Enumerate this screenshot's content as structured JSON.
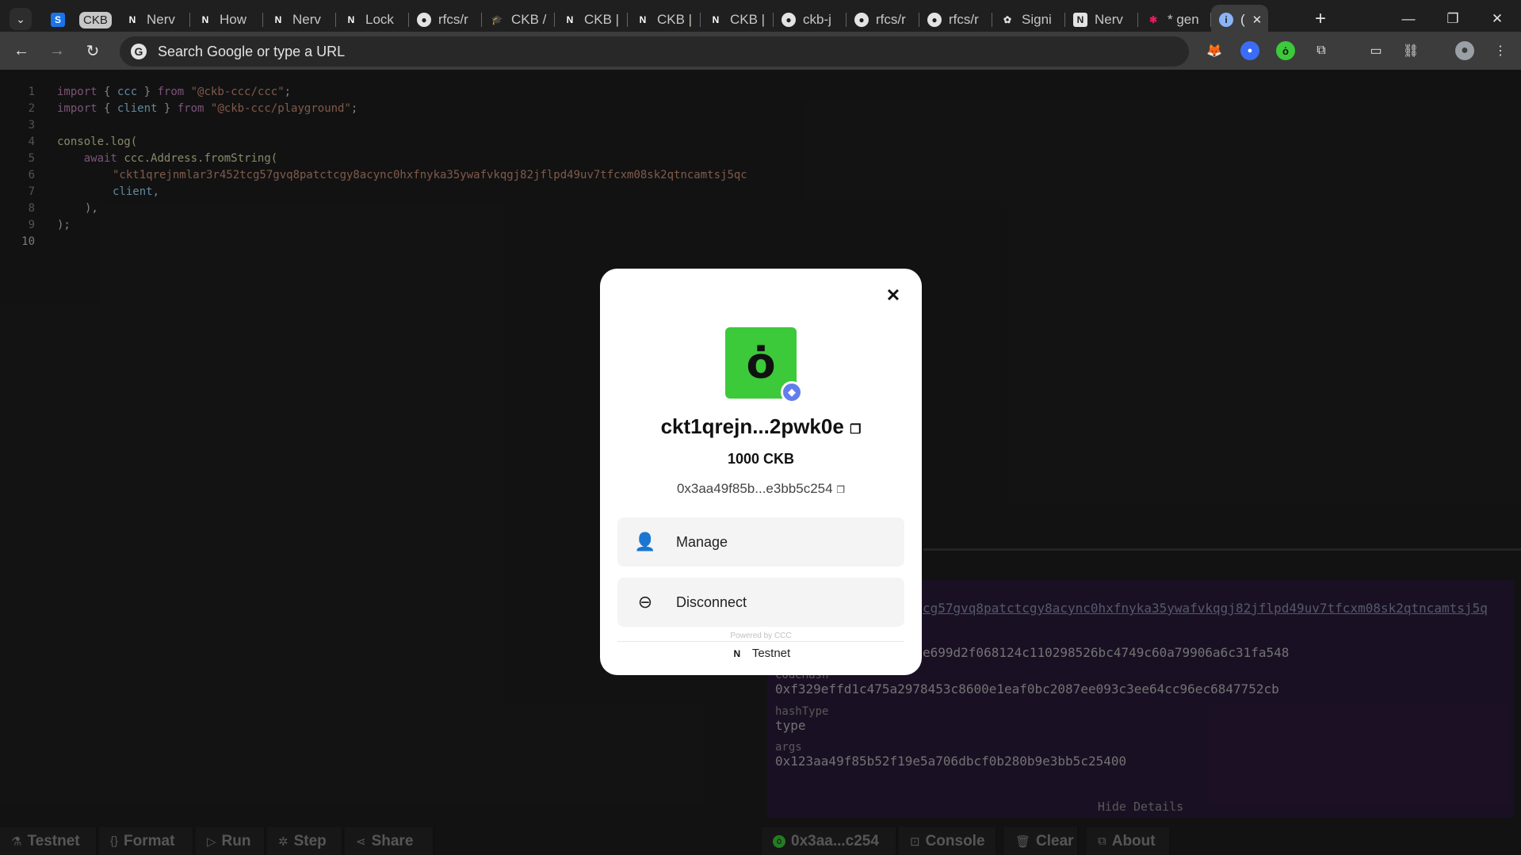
{
  "browser": {
    "tabs": [
      {
        "label": "",
        "icon": "s-app-icon",
        "color": "#1a73e8"
      },
      {
        "label": "CKB",
        "icon": "ckb-pill"
      },
      {
        "label": "Nerv",
        "icon": "nervos-icon"
      },
      {
        "label": "How",
        "icon": "nervos-icon"
      },
      {
        "label": "Nerv",
        "icon": "nervos-icon"
      },
      {
        "label": "Lock",
        "icon": "nervos-icon"
      },
      {
        "label": "rfcs/r",
        "icon": "github-icon"
      },
      {
        "label": "CKB /",
        "icon": "graduation-icon"
      },
      {
        "label": "CKB |",
        "icon": "nervos-icon"
      },
      {
        "label": "CKB |",
        "icon": "nervos-icon"
      },
      {
        "label": "CKB |",
        "icon": "nervos-icon"
      },
      {
        "label": "ckb-j",
        "icon": "github-icon"
      },
      {
        "label": "rfcs/r",
        "icon": "github-icon"
      },
      {
        "label": "rfcs/r",
        "icon": "github-icon"
      },
      {
        "label": "Signi",
        "icon": "openai-icon"
      },
      {
        "label": "Nerv",
        "icon": "nervos-box-icon"
      },
      {
        "label": "* gen",
        "icon": "slack-icon"
      },
      {
        "label": "(",
        "icon": "ccc-icon",
        "active": true
      }
    ],
    "omnibox_placeholder": "Search Google or type a URL"
  },
  "editor": {
    "lines": [
      {
        "n": "1"
      },
      {
        "n": "2"
      },
      {
        "n": "3"
      },
      {
        "n": "4"
      },
      {
        "n": "5"
      },
      {
        "n": "6"
      },
      {
        "n": "7"
      },
      {
        "n": "8"
      },
      {
        "n": "9"
      },
      {
        "n": "10"
      }
    ],
    "code": {
      "l1_import": "import",
      "l1_open": "{ ",
      "l1_name": "ccc",
      "l1_close": " }",
      "l1_from": "from",
      "l1_str": "\"@ckb-ccc/ccc\"",
      "l1_semi": ";",
      "l2_import": "import",
      "l2_open": "{ ",
      "l2_name": "client",
      "l2_close": " }",
      "l2_from": "from",
      "l2_str": "\"@ckb-ccc/playground\"",
      "l2_semi": ";",
      "l4": "console.log(",
      "l5_await": "await",
      "l5_rest": "ccc.Address.fromString(",
      "l6": "\"ckt1qrejnmlar3r452tcg57gvq8patctcgy8acync0hxfnyka35ywafvkqgj82jflpd49uv7tfcxm08sk2qtncamtsj5qc",
      "l7": "client,",
      "l8": "),",
      "l9": ");"
    }
  },
  "details": {
    "link_text": "cg57gvq8patctcgy8acync0hxfnyka35ywafvkqgj82jflpd49uv7tfcxm08sk2qtncamtsj5q",
    "partial_hash": "e699d2f068124c110298526bc4749c60a79906a6c31fa548",
    "codeHash_label": "codeHash",
    "codeHash": "0xf329effd1c475a2978453c8600e1eaf0bc2087ee093c3ee64cc96ec6847752cb",
    "hashType_label": "hashType",
    "hashType": "type",
    "args_label": "args",
    "args": "0x123aa49f85b52f19e5a706dbcf0b280b9e3bb5c25400",
    "hide_label": "Hide Details"
  },
  "bottombar": {
    "left": [
      {
        "label": "Testnet",
        "icon": "flask-icon"
      },
      {
        "label": "Format",
        "icon": "braces-icon"
      },
      {
        "label": "Run",
        "icon": "play-icon"
      },
      {
        "label": "Step",
        "icon": "bug-icon"
      },
      {
        "label": "Share",
        "icon": "share-icon"
      }
    ],
    "right": [
      {
        "label": "0x3aa...c254",
        "icon": "wallet-icon"
      },
      {
        "label": "Console",
        "icon": "terminal-icon"
      },
      {
        "label": "Clear",
        "icon": "trash-icon"
      },
      {
        "label": "About",
        "icon": "external-link-icon"
      }
    ]
  },
  "modal": {
    "address_short": "ckt1qrejn...2pwk0e",
    "balance": "1000 CKB",
    "eth_address": "0x3aa49f85b...e3bb5c254",
    "actions": [
      {
        "label": "Manage",
        "icon": "user-icon"
      },
      {
        "label": "Disconnect",
        "icon": "logout-icon"
      }
    ],
    "powered_by": "Powered by CCC",
    "network": "Testnet",
    "wallet_color": "#3cc93a",
    "badge_color": "#627eea"
  }
}
